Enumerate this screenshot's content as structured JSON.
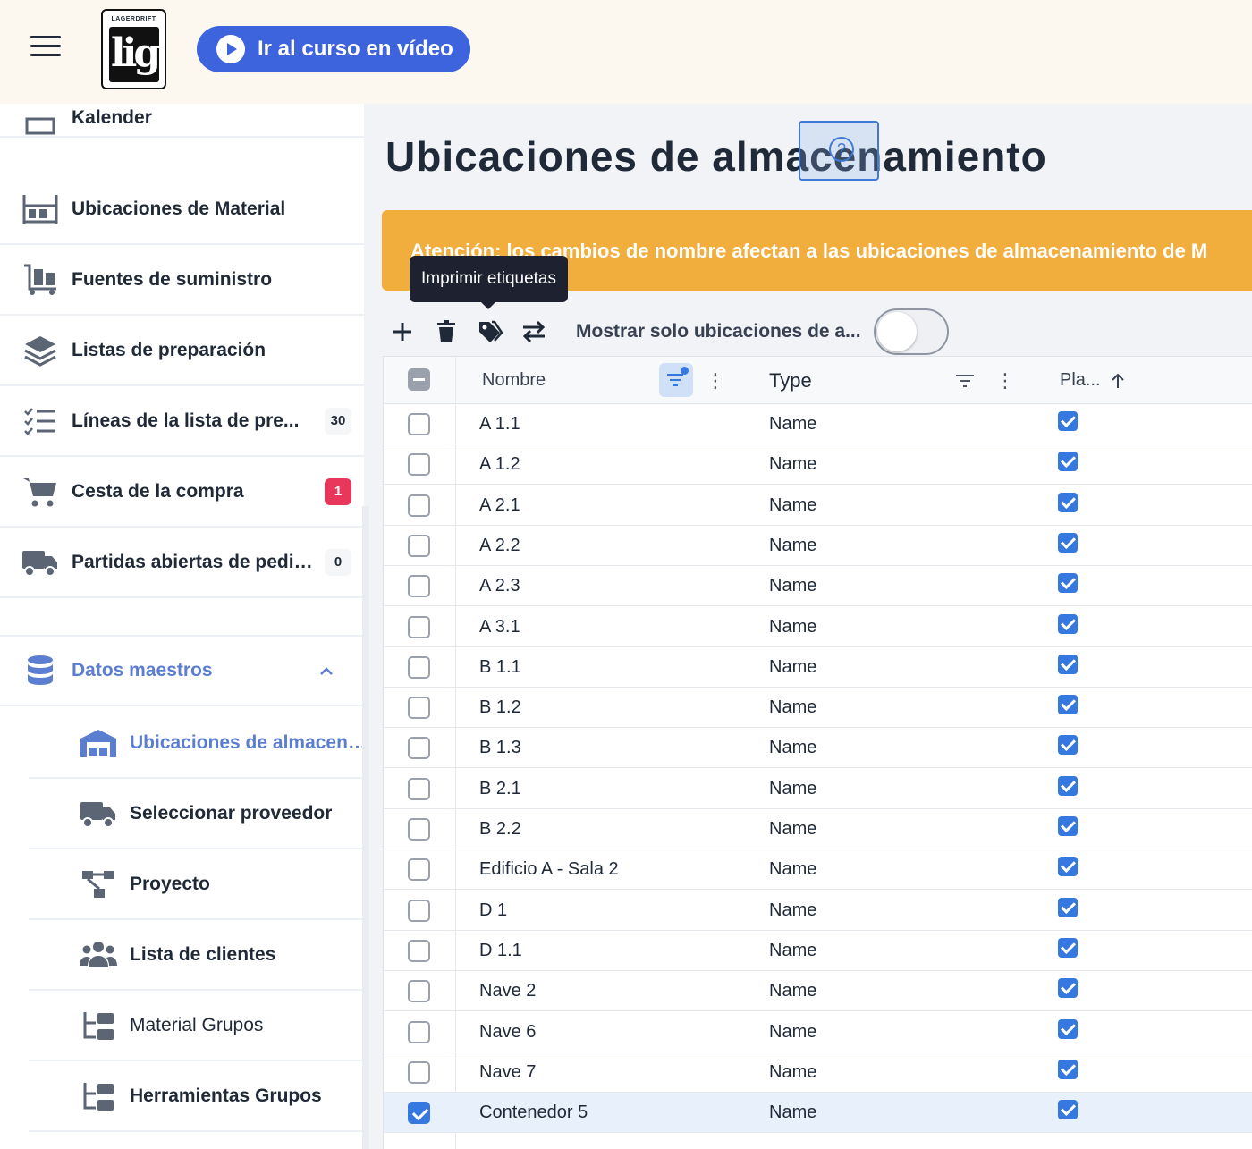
{
  "header": {
    "logo_text": "LAGERDRIFT",
    "logo_mark": "lig",
    "video_button": "Ir al curso en vídeo"
  },
  "sidebar": {
    "partial_item": "Kalender",
    "items": [
      {
        "label": "Ubicaciones de Material",
        "icon": "shelf-icon"
      },
      {
        "label": "Fuentes de suministro",
        "icon": "cart-dolly-icon"
      },
      {
        "label": "Listas de preparación",
        "icon": "layers-icon"
      },
      {
        "label": "Líneas de la lista de pre...",
        "icon": "checklist-icon",
        "badge": "30"
      },
      {
        "label": "Cesta de la compra",
        "icon": "shopping-cart-icon",
        "badge": "1"
      },
      {
        "label": "Partidas abiertas de pedido",
        "icon": "truck-icon",
        "badge": "0"
      }
    ],
    "section": {
      "label": "Datos maestros",
      "icon": "database-icon",
      "chevron": "^"
    },
    "sub_items": [
      {
        "label": "Ubicaciones de almacena...",
        "icon": "warehouse-icon"
      },
      {
        "label": "Seleccionar proveedor",
        "icon": "truck-icon"
      },
      {
        "label": "Proyecto",
        "icon": "project-tree-icon"
      },
      {
        "label": "Lista de clientes",
        "icon": "users-icon"
      },
      {
        "label": "Material Grupos",
        "icon": "folder-tree-icon"
      },
      {
        "label": "Herramientas Grupos",
        "icon": "folder-tree-icon"
      }
    ]
  },
  "main": {
    "title": "Ubicaciones de almacenamiento",
    "warning": "Atención: los cambios de nombre afectan a las ubicaciones de almacenamiento de M",
    "tooltip": "Imprimir etiquetas",
    "toolbar_label": "Mostrar solo ubicaciones de a...",
    "columns": {
      "name": "Nombre",
      "type": "Type",
      "placed": "Pla..."
    },
    "rows": [
      {
        "name": "A 1.1",
        "type": "Name",
        "selected": false
      },
      {
        "name": "A 1.2",
        "type": "Name",
        "selected": false
      },
      {
        "name": "A 2.1",
        "type": "Name",
        "selected": false
      },
      {
        "name": "A 2.2",
        "type": "Name",
        "selected": false
      },
      {
        "name": "A 2.3",
        "type": "Name",
        "selected": false
      },
      {
        "name": "A 3.1",
        "type": "Name",
        "selected": false
      },
      {
        "name": "B 1.1",
        "type": "Name",
        "selected": false
      },
      {
        "name": "B 1.2",
        "type": "Name",
        "selected": false
      },
      {
        "name": "B 1.3",
        "type": "Name",
        "selected": false
      },
      {
        "name": "B 2.1",
        "type": "Name",
        "selected": false
      },
      {
        "name": "B 2.2",
        "type": "Name",
        "selected": false
      },
      {
        "name": "Edificio A - Sala 2",
        "type": "Name",
        "selected": false
      },
      {
        "name": "D 1",
        "type": "Name",
        "selected": false
      },
      {
        "name": "D 1.1",
        "type": "Name",
        "selected": false
      },
      {
        "name": "Nave 2",
        "type": "Name",
        "selected": false
      },
      {
        "name": "Nave 6",
        "type": "Name",
        "selected": false
      },
      {
        "name": "Nave 7",
        "type": "Name",
        "selected": false
      },
      {
        "name": "Contenedor 5",
        "type": "Name",
        "selected": true
      }
    ]
  },
  "colors": {
    "accent": "#3d63dd",
    "warning": "#f2ae3d",
    "badge_red": "#e8375b",
    "link": "#5c7ed0"
  }
}
